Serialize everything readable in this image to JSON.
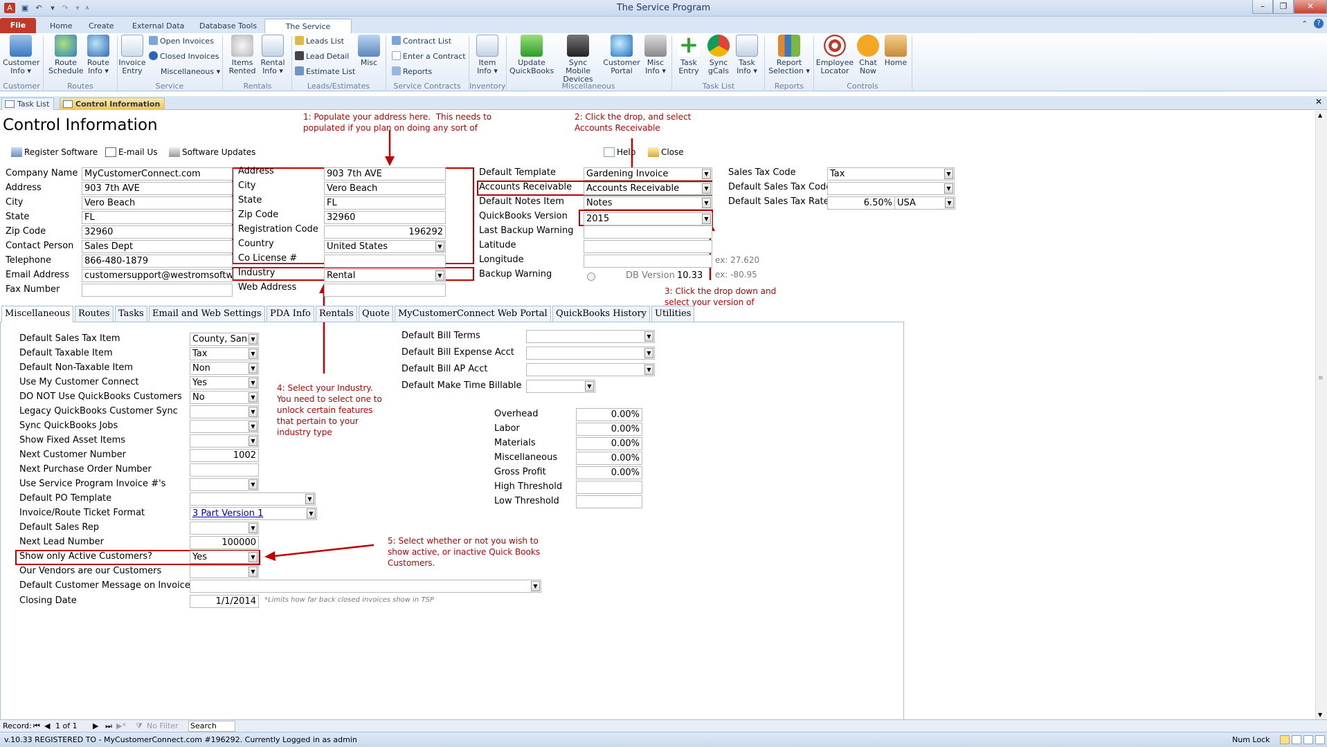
{
  "window": {
    "title": "The Service Program"
  },
  "ribbon_tabs": [
    "File",
    "Home",
    "Create",
    "External Data",
    "Database Tools",
    "The Service Program"
  ],
  "ribbon": {
    "customer_info": "Customer Info",
    "route_schedule": "Route Schedule",
    "route_info": "Route Info",
    "invoice_entry": "Invoice Entry",
    "open_invoices": "Open Invoices",
    "closed_invoices": "Closed Invoices",
    "miscellaneous": "Miscellaneous",
    "items_rented": "Items Rented",
    "rental_info": "Rental Info",
    "leads_list": "Leads List",
    "lead_detail": "Lead Detail",
    "estimate_list": "Estimate List",
    "misc": "Misc",
    "contract_list": "Contract List",
    "enter_contract": "Enter a Contract",
    "reports_small": "Reports",
    "item_info": "Item Info",
    "update_qb": "Update QuickBooks",
    "sync_mobile": "Sync Mobile Devices",
    "customer_portal": "Customer Portal",
    "misc_info": "Misc Info",
    "task_entry": "Task Entry",
    "sync_gcals": "Sync gCals",
    "task_info": "Task Info",
    "report_selection": "Report Selection",
    "employee_locator": "Employee Locator",
    "chat_now": "Chat Now",
    "home": "Home",
    "groups": {
      "customer": "Customer",
      "routes": "Routes",
      "service": "Service",
      "rentals": "Rentals",
      "leads": "Leads/Estimates",
      "contracts": "Service Contracts",
      "inventory": "Inventory",
      "miscellaneous": "Miscellaneous",
      "task_list": "Task List",
      "reports": "Reports",
      "controls": "Controls"
    }
  },
  "doc_tabs": [
    "Task List",
    "Control Information"
  ],
  "form": {
    "title": "Control Information",
    "toolbar": {
      "register": "Register Software",
      "email": "E-mail Us",
      "updates": "Software Updates",
      "help": "Help",
      "close": "Close"
    },
    "company": {
      "labels": [
        "Company Name",
        "Address",
        "City",
        "State",
        "Zip Code",
        "Contact Person",
        "Telephone",
        "Email Address",
        "Fax Number"
      ],
      "values": [
        "MyCustomerConnect.com",
        "903 7th AVE",
        "Vero Beach",
        "FL",
        "32960",
        "Sales Dept",
        "866-480-1879",
        "customersupport@westromsoftware",
        ""
      ]
    },
    "registration": {
      "labels": [
        "Address",
        "City",
        "State",
        "Zip Code",
        "Registration Code",
        "Country",
        "Co License #",
        "Industry",
        "Web Address"
      ],
      "values": [
        "903 7th AVE",
        "Vero Beach",
        "FL",
        "32960",
        "196292",
        "United States",
        "",
        "Rental",
        ""
      ]
    },
    "defaults": {
      "labels": [
        "Default Template",
        "Accounts Receivable",
        "Default Notes Item",
        "QuickBooks Version",
        "Last Backup Warning",
        "Latitude",
        "Longitude",
        "Backup Warning"
      ],
      "values": [
        "Gardening Invoice",
        "Accounts Receivable",
        "Notes",
        "2015",
        "",
        "",
        "",
        ""
      ],
      "latitude_hint": "ex: 27.620",
      "longitude_hint": "ex: -80.95",
      "db_version_label": "DB Version",
      "db_version": "10.33"
    },
    "tax": {
      "labels": [
        "Sales Tax Code",
        "Default Sales Tax Code",
        "Default Sales Tax Rate"
      ],
      "values": [
        "Tax",
        "",
        "6.50%"
      ],
      "country": "USA"
    }
  },
  "sub_tabs": [
    "Miscellaneous",
    "Routes",
    "Tasks",
    "Email and Web Settings",
    "PDA Info",
    "Rentals",
    "Quote",
    "MyCustomerConnect Web Portal",
    "QuickBooks History",
    "Utilities"
  ],
  "misc": {
    "rows": [
      {
        "label": "Default Sales Tax Item",
        "value": "County, San T"
      },
      {
        "label": "Default Taxable Item",
        "value": "Tax"
      },
      {
        "label": "Default Non-Taxable Item",
        "value": "Non"
      },
      {
        "label": "Use My Customer Connect",
        "value": "Yes"
      },
      {
        "label": "DO NOT Use QuickBooks Customers",
        "value": "No"
      },
      {
        "label": "Legacy QuickBooks Customer Sync",
        "value": ""
      },
      {
        "label": "Sync QuickBooks Jobs",
        "value": ""
      },
      {
        "label": "Show Fixed Asset Items",
        "value": ""
      },
      {
        "label": "Next Customer Number",
        "value": "1002"
      },
      {
        "label": "Next Purchase Order Number",
        "value": ""
      },
      {
        "label": "Use Service Program Invoice #'s",
        "value": ""
      },
      {
        "label": "Default PO Template",
        "value": ""
      },
      {
        "label": "Invoice/Route Ticket Format",
        "value": "3 Part Version 1"
      },
      {
        "label": "Default Sales Rep",
        "value": ""
      },
      {
        "label": "Next Lead Number",
        "value": "100000"
      },
      {
        "label": "Show only Active Customers?",
        "value": "Yes"
      },
      {
        "label": "Our Vendors are our Customers",
        "value": ""
      },
      {
        "label": "Default Customer Message on Invoice",
        "value": ""
      },
      {
        "label": "Closing Date",
        "value": "1/1/2014"
      }
    ],
    "closing_note": "*Limits how far back closed invoices show in TSP",
    "bill": {
      "labels": [
        "Default Bill Terms",
        "Default Bill Expense Acct",
        "Default Bill AP Acct",
        "Default Make Time Billable"
      ]
    },
    "costs": {
      "labels": [
        "Overhead",
        "Labor",
        "Materials",
        "Miscellaneous",
        "Gross Profit",
        "High Threshold",
        "Low Threshold"
      ],
      "values": [
        "0.00%",
        "0.00%",
        "0.00%",
        "0.00%",
        "0.00%",
        "",
        ""
      ]
    }
  },
  "annotations": {
    "a1": "1: Populate your address here.  This needs to\npopulated if you plan on doing any sort of",
    "a2": "2: Click the drop, and select\nAccounts Receivable",
    "a3": "3: Click the drop down and\nselect your version of",
    "a4": "4: Select your Industry.\nYou need to select one to\nunlock certain features\nthat pertain to your\nindustry type",
    "a5": "5: Select whether or not you wish to\nshow active, or inactive Quick Books\nCustomers."
  },
  "navbar": {
    "record_label": "Record:",
    "record_pos": "1 of 1",
    "filter": "No Filter",
    "search": "Search"
  },
  "status": {
    "text": "v.10.33 REGISTERED TO - MyCustomerConnect.com #196292. Currently Logged in as admin",
    "numlock": "Num Lock"
  }
}
